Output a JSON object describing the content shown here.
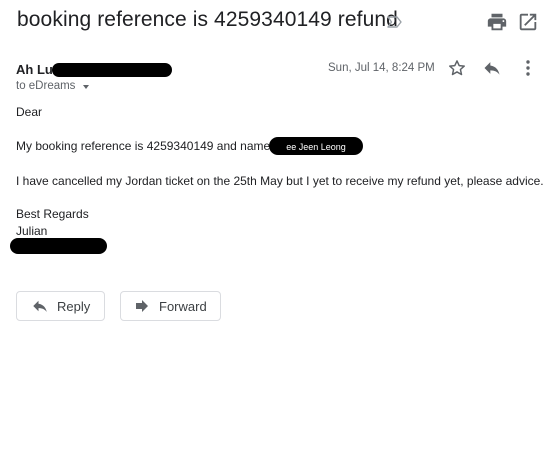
{
  "email": {
    "subject": "booking reference is 4259340149 refund",
    "sender_name": "Ah Lu",
    "to_line": "to eDreams",
    "date": "Sun, Jul 14, 8:24 PM",
    "body": {
      "greeting": "Dear",
      "line1": "My  booking reference is 4259340149 and name",
      "redacted_name_fragment": "ee Jeen Leong",
      "line2": "I have cancelled my Jordan ticket on the 25th May but I yet to receive my refund yet, please advice.",
      "closing": "Best Regards",
      "signature": "Julian"
    }
  },
  "actions": {
    "reply_label": "Reply",
    "forward_label": "Forward"
  },
  "icons": {
    "label": "label-outline-icon",
    "print": "print-icon",
    "popout": "open-in-new-window-icon",
    "star": "star-icon",
    "reply": "reply-icon",
    "more": "more-vertical-icon",
    "forward": "forward-icon"
  },
  "colors": {
    "text": "#202124",
    "secondary_text": "#5f6368",
    "icon": "#5f6368",
    "button_border": "#dadce0",
    "redaction": "#000000"
  }
}
